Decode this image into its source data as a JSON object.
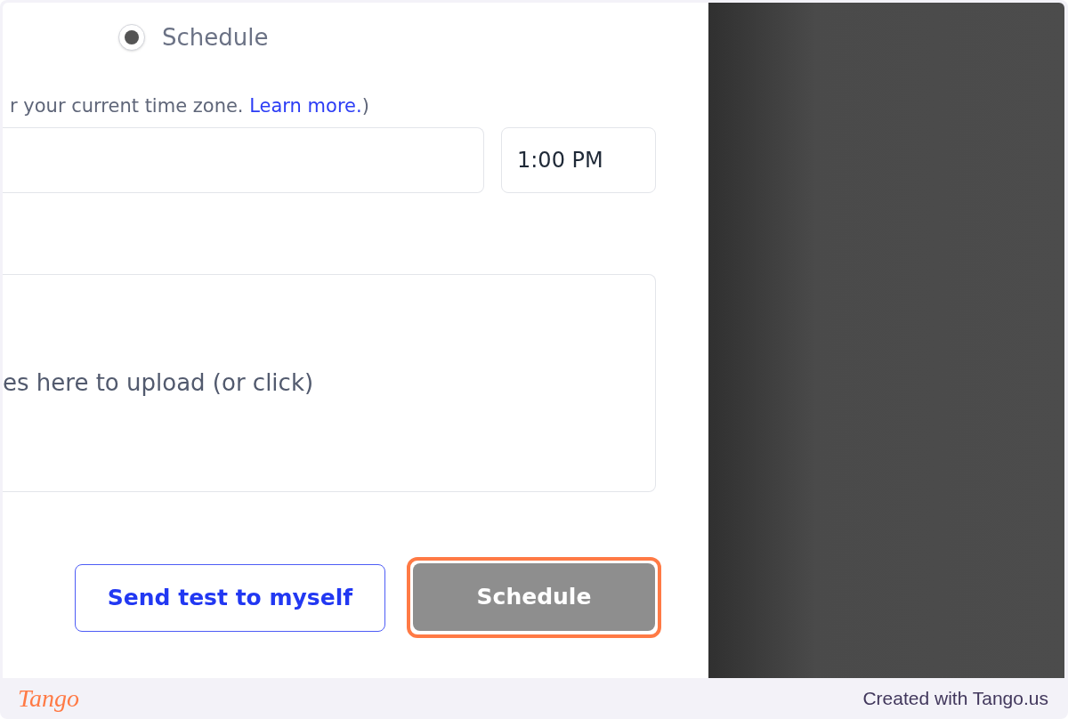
{
  "delivery_option": {
    "label": "Schedule",
    "selected": true
  },
  "timezone_note": {
    "text": "r your current time zone.",
    "link": "Learn more.",
    "after_link": ")"
  },
  "time_field": {
    "value": "1:00 PM"
  },
  "upload_area": {
    "text": "es here to upload (or click)"
  },
  "buttons": [
    {
      "label": "Send test to myself",
      "kind": "outline",
      "highlighted": false
    },
    {
      "label": "Schedule",
      "kind": "filled",
      "highlighted": true
    }
  ],
  "footer": {
    "logo": "Tango",
    "credit": "Created with Tango.us"
  }
}
